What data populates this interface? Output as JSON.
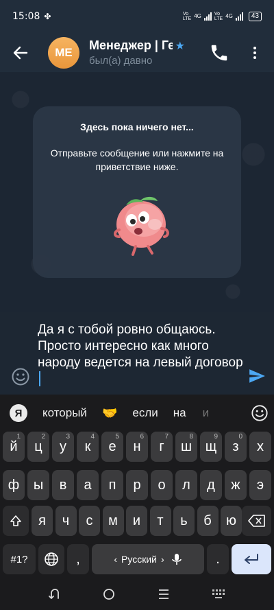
{
  "status": {
    "time": "15:08",
    "net1": "Vo LTE",
    "net2": "4G",
    "net3": "Vo LTE",
    "net4": "4G",
    "battery": "43"
  },
  "header": {
    "avatar_initials": "МЕ",
    "title": "Менеджер | Ге",
    "subtitle": "был(а) давно",
    "star_icon": "star-icon",
    "colors": {
      "accent": "#4ca8f3",
      "avatar": "#f0a24b",
      "header_bg": "#212d3b"
    }
  },
  "chat": {
    "empty_title": "Здесь пока ничего нет...",
    "empty_text": "Отправьте сообщение или нажмите на приветствие ниже."
  },
  "composer": {
    "message": "Да я с тобой ровно общаюсь. Просто интересно как много народу ведется на левый договор"
  },
  "keyboard": {
    "brand": "Я",
    "suggestions": [
      "который",
      "если",
      "на",
      "и"
    ],
    "row1": [
      {
        "k": "й",
        "s": "1"
      },
      {
        "k": "ц",
        "s": "2"
      },
      {
        "k": "у",
        "s": "3"
      },
      {
        "k": "к",
        "s": "4"
      },
      {
        "k": "е",
        "s": "5"
      },
      {
        "k": "н",
        "s": "6"
      },
      {
        "k": "г",
        "s": "7"
      },
      {
        "k": "ш",
        "s": "8"
      },
      {
        "k": "щ",
        "s": "9"
      },
      {
        "k": "з",
        "s": "0"
      },
      {
        "k": "х",
        "s": ""
      }
    ],
    "row2": [
      "ф",
      "ы",
      "в",
      "а",
      "п",
      "р",
      "о",
      "л",
      "д",
      "ж",
      "э"
    ],
    "row3": [
      "я",
      "ч",
      "с",
      "м",
      "и",
      "т",
      "ь",
      "б",
      "ю"
    ],
    "sym_label": "#1?",
    "comma": ",",
    "space_label": "Русский",
    "period": "."
  }
}
